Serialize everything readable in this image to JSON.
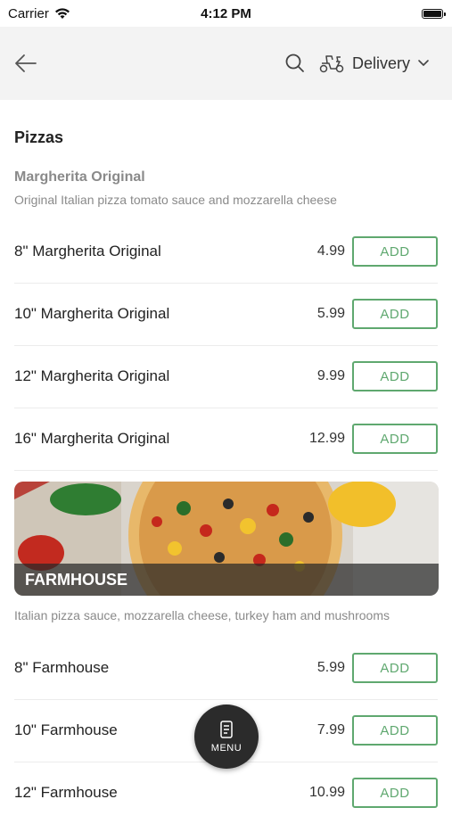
{
  "status_bar": {
    "carrier": "Carrier",
    "time": "4:12 PM"
  },
  "nav": {
    "back_icon": "arrow-left-icon",
    "search_icon": "search-icon",
    "delivery_icon": "scooter-icon",
    "delivery_label": "Delivery"
  },
  "section": {
    "title": "Pizzas"
  },
  "product1": {
    "name": "Margherita Original",
    "description": "Original Italian pizza tomato sauce and mozzarella cheese",
    "items": [
      {
        "name": "8\" Margherita Original",
        "price": "4.99",
        "button": "ADD"
      },
      {
        "name": "10\" Margherita Original",
        "price": "5.99",
        "button": "ADD"
      },
      {
        "name": "12\" Margherita Original",
        "price": "9.99",
        "button": "ADD"
      },
      {
        "name": "16\" Margherita Original",
        "price": "12.99",
        "button": "ADD"
      }
    ]
  },
  "banner": {
    "label": "FARMHOUSE",
    "description": "Italian pizza sauce, mozzarella cheese, turkey ham and mushrooms"
  },
  "product2": {
    "items": [
      {
        "name": "8\" Farmhouse",
        "price": "5.99",
        "button": "ADD"
      },
      {
        "name": "10\" Farmhouse",
        "price": "7.99",
        "button": "ADD"
      },
      {
        "name": "12\" Farmhouse",
        "price": "10.99",
        "button": "ADD"
      }
    ]
  },
  "menu_fab": {
    "label": "MENU",
    "icon": "menu-card-icon"
  },
  "colors": {
    "accent": "#5fa86f",
    "header_bg": "#f3f3f3",
    "fab_bg": "#2b2b2b"
  }
}
